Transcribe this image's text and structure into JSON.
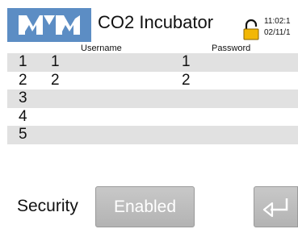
{
  "header": {
    "title": "CO2 Incubator",
    "time": "11:02:1",
    "date": "02/11/1"
  },
  "table": {
    "headers": {
      "username": "Username",
      "password": "Password"
    },
    "rows": [
      {
        "num": "1",
        "username": "1",
        "password": "1"
      },
      {
        "num": "2",
        "username": "2",
        "password": "2"
      },
      {
        "num": "3",
        "username": "",
        "password": ""
      },
      {
        "num": "4",
        "username": "",
        "password": ""
      },
      {
        "num": "5",
        "username": "",
        "password": ""
      }
    ]
  },
  "footer": {
    "security_label": "Security",
    "enabled_label": "Enabled"
  },
  "icons": {
    "logo": "mm-logo-icon",
    "lock": "lock-open-icon",
    "enter": "enter-return-icon"
  },
  "colors": {
    "logo_bg": "#5c8dc4",
    "row_shade": "#e1e1e1",
    "button_gray": "#bdbdbd",
    "lock_yellow": "#f2b705"
  }
}
